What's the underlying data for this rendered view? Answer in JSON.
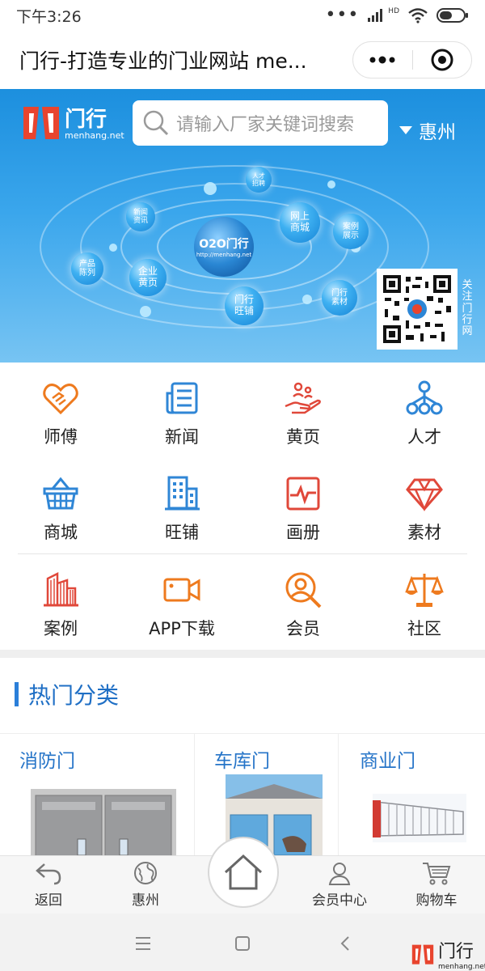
{
  "status_bar": {
    "time": "下午3:26",
    "network": "HD"
  },
  "titlebar": {
    "title": "门行-打造专业的门业网站 me..."
  },
  "banner": {
    "logo_cn": "门行",
    "logo_en": "menhang.net",
    "search_placeholder": "请输入厂家关键词搜索",
    "city": "惠州",
    "globe_text": "O2O门行",
    "globe_site": "http://menhang.net",
    "bubbles": {
      "talent": "人才\n招聘",
      "news": "新闻\n资讯",
      "mall": "网上\n商城",
      "cases": "案例\n展示",
      "products": "产品\n陈列",
      "yellow": "企业\n黄页",
      "shops": "门行\n旺铺",
      "material": "门行\n素材"
    },
    "qr_side_text": "关注门行网"
  },
  "grid": [
    [
      {
        "label": "师傅",
        "icon": "handshake-icon"
      },
      {
        "label": "新闻",
        "icon": "news-icon"
      },
      {
        "label": "黄页",
        "icon": "hand-people-icon"
      },
      {
        "label": "人才",
        "icon": "org-chart-icon"
      }
    ],
    [
      {
        "label": "商城",
        "icon": "basket-icon"
      },
      {
        "label": "旺铺",
        "icon": "building-icon"
      },
      {
        "label": "画册",
        "icon": "pulse-icon"
      },
      {
        "label": "素材",
        "icon": "diamond-icon"
      }
    ],
    [
      {
        "label": "案例",
        "icon": "city-icon"
      },
      {
        "label": "APP下载",
        "icon": "video-icon"
      },
      {
        "label": "会员",
        "icon": "member-search-icon"
      },
      {
        "label": "社区",
        "icon": "scales-icon"
      }
    ]
  ],
  "hot": {
    "title": "热门分类",
    "categories": [
      {
        "name": "消防门"
      },
      {
        "name": "车库门"
      },
      {
        "name": "商业门"
      }
    ]
  },
  "bottom_nav": {
    "back": "返回",
    "city": "惠州",
    "member": "会员中心",
    "cart": "购物车"
  },
  "watermark": {
    "cn": "门行",
    "en": "menhang.net"
  },
  "colors": {
    "accent_blue": "#2574c8",
    "icon_orange": "#ee7a1e",
    "icon_blue": "#2f86d6",
    "icon_red": "#e0483a"
  }
}
